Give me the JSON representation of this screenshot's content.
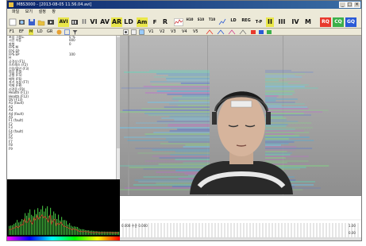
{
  "window": {
    "title": "MBS3000 - [2013-08-05 11.56.04.avi]",
    "controls": [
      "_",
      "□",
      "×"
    ]
  },
  "menu": [
    "파일",
    "보기",
    "설정",
    "창"
  ],
  "toolbar_main": [
    {
      "label": "AVI",
      "color": "#e9e64a"
    },
    {
      "label": "II"
    },
    {
      "label": "VI"
    },
    {
      "label": "AV"
    },
    {
      "label": "AR",
      "color": "#e9e64a"
    },
    {
      "label": "LD"
    },
    {
      "label": "Am",
      "color": "#e9e64a"
    },
    {
      "label": "F"
    },
    {
      "label": "R"
    },
    {
      "label": "LD"
    },
    {
      "label": "REG"
    },
    {
      "label": "II",
      "color": "#e9e64a"
    },
    {
      "label": "III"
    },
    {
      "label": "IV"
    },
    {
      "label": "M"
    },
    {
      "label": "RQ",
      "color": "#e8392c"
    },
    {
      "label": "CQ",
      "color": "#3cb04a"
    },
    {
      "label": "GQ",
      "color": "#2a5ad6"
    }
  ],
  "toolbar_secondary": [
    "F1",
    "EF",
    "M",
    "LD",
    "GR",
    "V1",
    "V2",
    "V3",
    "V4",
    "V5"
  ],
  "measurements": [
    {
      "key": "초점 그룹도",
      "value": "0 %"
    },
    {
      "key": "시선 이동",
      "value": "000"
    },
    {
      "key": "파형",
      "value": "0"
    },
    {
      "key": "FPS M",
      "value": ""
    },
    {
      "key": "FPS EP",
      "value": ""
    },
    {
      "key": "FPS EP",
      "value": "100"
    },
    {
      "key": "H",
      "value": ""
    },
    {
      "key": "공격성 (F1)",
      "value": ""
    },
    {
      "key": "스트레스 (F2)",
      "value": ""
    },
    {
      "key": "긴장/불안 (F3)",
      "value": ""
    },
    {
      "key": "의심 (F4)",
      "value": ""
    },
    {
      "key": "균형 (F5)",
      "value": ""
    },
    {
      "key": "매력 (F6)",
      "value": ""
    },
    {
      "key": "자기 조절 (F7)",
      "value": ""
    },
    {
      "key": "억제 (F8)",
      "value": ""
    },
    {
      "key": "신경증 (F9)",
      "value": ""
    },
    {
      "key": "Health (F11)",
      "value": ""
    },
    {
      "key": "Health (F12)",
      "value": ""
    },
    {
      "key": "DV (F13)",
      "value": ""
    },
    {
      "key": "A1 (fault)",
      "value": ""
    },
    {
      "key": "A2",
      "value": ""
    },
    {
      "key": "A3",
      "value": ""
    },
    {
      "key": "A4 (fault)",
      "value": ""
    },
    {
      "key": "A5",
      "value": ""
    },
    {
      "key": "F1 (fault)",
      "value": ""
    },
    {
      "key": "F2",
      "value": ""
    },
    {
      "key": "F3",
      "value": ""
    },
    {
      "key": "F4 (fault)",
      "value": ""
    },
    {
      "key": "F5",
      "value": ""
    },
    {
      "key": "F6",
      "value": ""
    },
    {
      "key": "F7",
      "value": ""
    },
    {
      "key": "F8",
      "value": ""
    },
    {
      "key": "F9",
      "value": ""
    }
  ],
  "graph": {
    "label": "0.000 수준 0.000",
    "right_top": "1.00",
    "right_bottom": "0.00"
  },
  "colors": {
    "title_bar": "#0a246a",
    "accent_yellow": "#e9e64a",
    "accent_red": "#e8392c",
    "accent_green": "#3cb04a",
    "accent_blue": "#2a5ad6"
  }
}
